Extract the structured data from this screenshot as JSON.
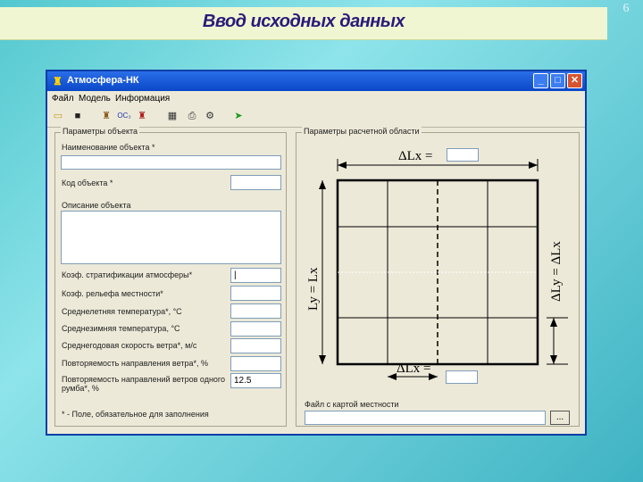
{
  "slide": {
    "title": "Ввод исходных данных",
    "page_number": "6"
  },
  "window": {
    "title": "Атмосфера-НК",
    "controls": {
      "minimize": "_",
      "maximize": "□",
      "close": "✕"
    }
  },
  "menu": {
    "items": [
      "Файл",
      "Модель",
      "Информация"
    ]
  },
  "toolbar": {
    "icons": [
      "open-folder-icon",
      "save-disk-icon",
      "factory-icon",
      "oc3-icon",
      "factory-alt-icon",
      "calculator-icon",
      "print-icon",
      "gear-icon",
      "run-icon"
    ],
    "oc3_label": "ОС₃"
  },
  "object_params": {
    "group_label": "Параметры объекта",
    "name_label": "Наименование объекта *",
    "name_value": "",
    "code_label": "Код объекта *",
    "code_value": "",
    "description_label": "Описание объекта",
    "description_value": "",
    "fields": [
      {
        "label": "Коэф. стратификации атмосферы*",
        "value": "|"
      },
      {
        "label": "Коэф. рельефа местности*",
        "value": ""
      },
      {
        "label": "Среднелетняя температура*, °С",
        "value": ""
      },
      {
        "label": "Среднезимняя температура, °С",
        "value": ""
      },
      {
        "label": "Среднегодовая скорость ветра*, м/с",
        "value": ""
      },
      {
        "label": "Повторяемость направления ветра*, %",
        "value": ""
      },
      {
        "label": "Повторяемость направлений ветров одного румба*, %",
        "value": "12.5"
      }
    ],
    "required_note": "* - Поле, обязательное для заполнения"
  },
  "calc_area": {
    "group_label": "Параметры расчетной области",
    "top_label": "ΔLx =",
    "bottom_label": "ΔLx =",
    "left_label": "Ly = Lx",
    "right_label": "ΔLy = ΔLx",
    "top_value": "",
    "bottom_value": "",
    "map_file_label": "Файл с картой местности",
    "map_file_value": "",
    "browse_label": "..."
  },
  "colors": {
    "slide_title": "#2a1a7a",
    "window_title_bg": "#0a48c8",
    "window_bg": "#ece9d8"
  }
}
